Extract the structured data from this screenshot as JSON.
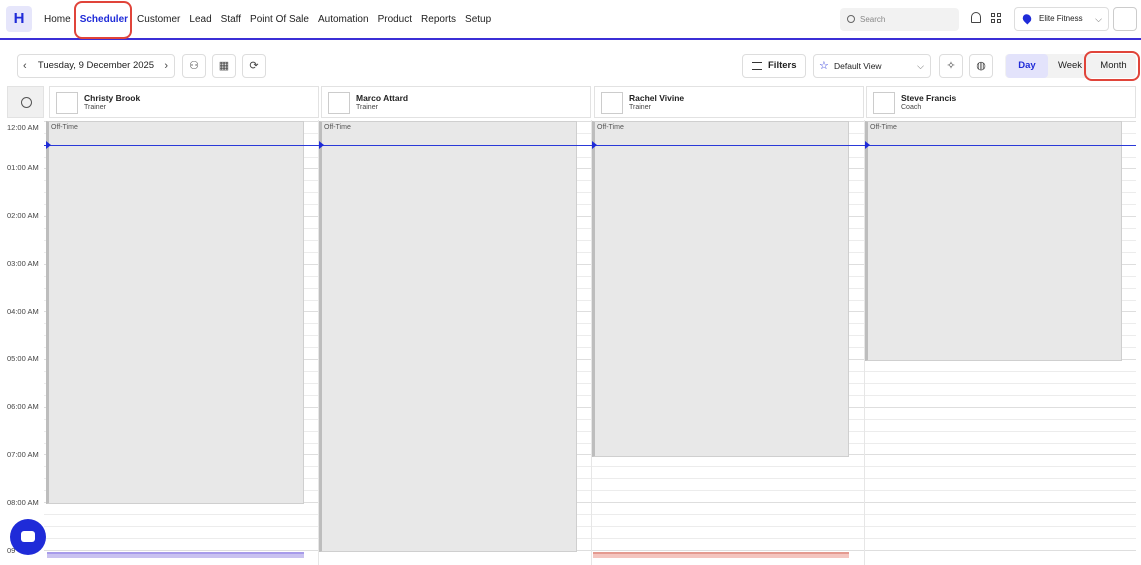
{
  "app": {
    "logo": "H"
  },
  "nav": {
    "items": [
      "Home",
      "Scheduler",
      "Customer",
      "Lead",
      "Staff",
      "Point Of Sale",
      "Automation",
      "Product",
      "Reports",
      "Setup"
    ],
    "active": "Scheduler"
  },
  "header": {
    "search_placeholder": "Search",
    "location": "Elite Fitness"
  },
  "toolbar": {
    "prev": "‹",
    "date": "Tuesday, 9 December 2025",
    "next": "›",
    "filters": "Filters",
    "view": "Default View",
    "tabs": [
      "Day",
      "Week",
      "Month"
    ],
    "active_tab": "Day"
  },
  "time_labels": [
    "12:00 AM",
    "01:00 AM",
    "02:00 AM",
    "03:00 AM",
    "04:00 AM",
    "05:00 AM",
    "06:00 AM",
    "07:00 AM",
    "08:00 AM",
    "09"
  ],
  "staff": [
    {
      "name": "Christy Brook",
      "role": "Trainer"
    },
    {
      "name": "Marco Attard",
      "role": "Trainer"
    },
    {
      "name": "Rachel Vivine",
      "role": "Trainer"
    },
    {
      "name": "Steve Francis",
      "role": "Coach"
    }
  ],
  "off_label": "Off-Time",
  "colors": {
    "accent": "#1f2bd8",
    "highlight": "#e0443a",
    "event_purple": "#c9c2f0",
    "event_red": "#f4c5bf"
  }
}
